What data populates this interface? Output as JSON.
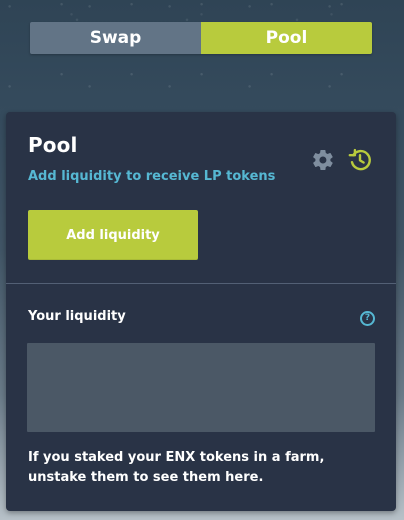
{
  "tabs": {
    "swap": "Swap",
    "pool": "Pool",
    "active": "Pool"
  },
  "pool_panel": {
    "title": "Pool",
    "subtitle": "Add liquidity to receive LP tokens",
    "settings_icon": "gear-icon",
    "history_icon": "history-icon",
    "add_button": "Add liquidity",
    "your_liquidity_label": "Your liquidity",
    "help_icon": "?",
    "staking_notice": "If you staked your ENX tokens in a farm, unstake them to see them here."
  },
  "colors": {
    "accent": "#b8cb3d",
    "link": "#56b8d3",
    "card_background": "#293346",
    "inactive_tab": "#627486"
  }
}
